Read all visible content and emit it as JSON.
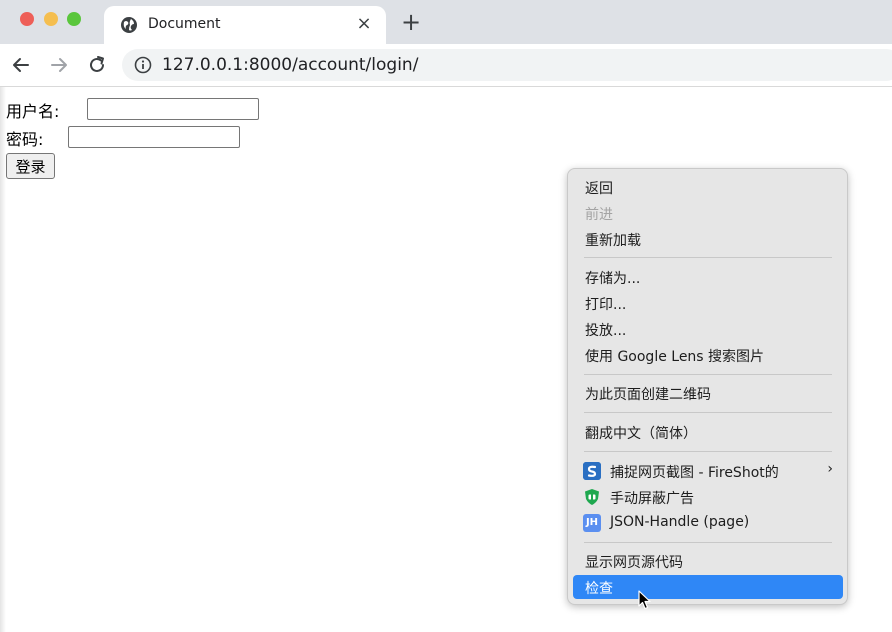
{
  "browser": {
    "tab": {
      "title": "Document",
      "favicon": "globe-icon",
      "close_label": "×"
    },
    "new_tab_label": "+",
    "url": "127.0.0.1:8000/account/login/"
  },
  "form": {
    "username_label": "用户名:",
    "password_label": "密码:",
    "username_value": "",
    "password_value": "",
    "submit_label": "登录"
  },
  "context_menu": {
    "items": [
      {
        "label": "返回",
        "enabled": true
      },
      {
        "label": "前进",
        "enabled": false
      },
      {
        "label": "重新加载",
        "enabled": true
      },
      {
        "label": "存储为...",
        "enabled": true
      },
      {
        "label": "打印...",
        "enabled": true
      },
      {
        "label": "投放...",
        "enabled": true
      },
      {
        "label": "使用 Google Lens 搜索图片",
        "enabled": true
      },
      {
        "label": "为此页面创建二维码",
        "enabled": true
      },
      {
        "label": "翻成中文（简体）",
        "enabled": true
      },
      {
        "label": "捕捉网页截图 - FireShot的",
        "icon": "fireshot-icon",
        "submenu": true
      },
      {
        "label": "手动屏蔽广告",
        "icon": "adblock-shield-icon"
      },
      {
        "label": "JSON-Handle (page)",
        "icon": "json-handle-icon",
        "icon_text": "JH"
      },
      {
        "label": "显示网页源代码",
        "enabled": true
      },
      {
        "label": "检查",
        "enabled": true,
        "highlighted": true
      }
    ]
  },
  "colors": {
    "highlight": "#2f87f6",
    "tabstrip": "#dee1e6",
    "close_dot": "#ee5f58",
    "minimize_dot": "#f5be4f",
    "zoom_dot": "#5ac63c"
  }
}
